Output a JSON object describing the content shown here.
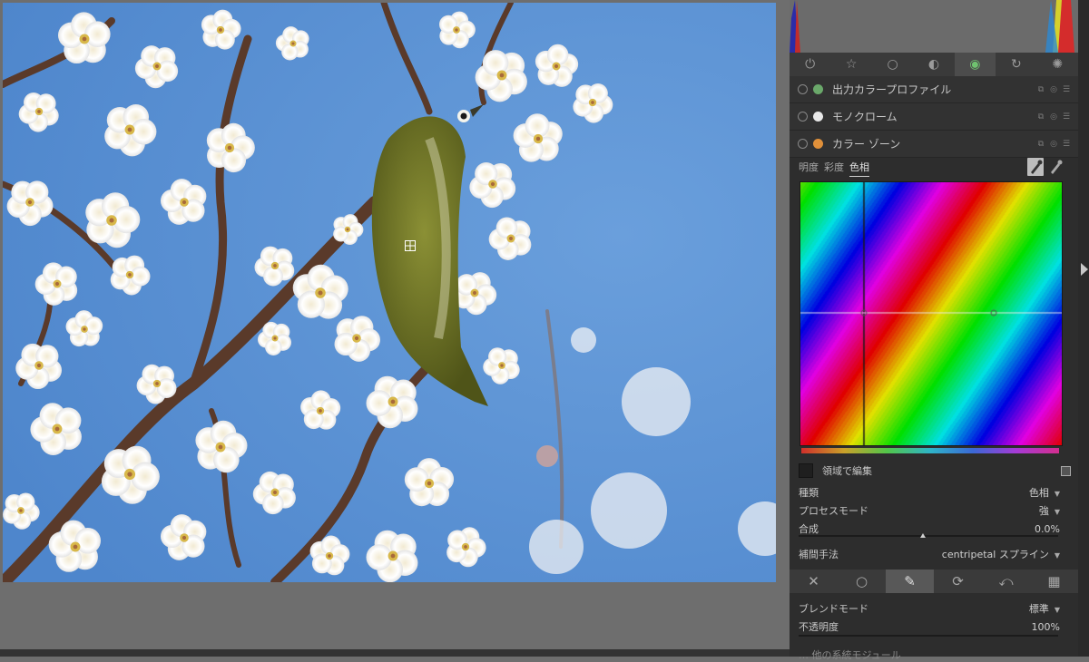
{
  "module_tabs": [
    {
      "icon": "power-icon",
      "glyph": "⏻"
    },
    {
      "icon": "star-icon",
      "glyph": "☆"
    },
    {
      "icon": "circle-icon",
      "glyph": "○"
    },
    {
      "icon": "half-circle-icon",
      "glyph": "◐"
    },
    {
      "icon": "color-wheel-icon",
      "glyph": "◉",
      "active": true
    },
    {
      "icon": "refresh-icon",
      "glyph": "↻"
    },
    {
      "icon": "aperture-icon",
      "glyph": "✺"
    }
  ],
  "modules": [
    {
      "name": "出力カラープロファイル",
      "icon": "output-color-profile-icon",
      "color": "#6aa86a"
    },
    {
      "name": "モノクローム",
      "icon": "monochrome-icon",
      "color": "#e8e8e8"
    },
    {
      "name": "カラー ゾーン",
      "icon": "color-zones-icon",
      "color": "#e0903a"
    }
  ],
  "module_buttons": [
    "⧉",
    "◎",
    "☰"
  ],
  "color_zones": {
    "tabs": [
      "明度",
      "彩度",
      "色相"
    ],
    "active_tab": "色相",
    "area_edit_label": "領域で編集",
    "params": [
      {
        "label": "種類",
        "value": "色相",
        "dropdown": true
      },
      {
        "label": "プロセスモード",
        "value": "強",
        "dropdown": true
      },
      {
        "label": "合成",
        "value": "0.0%",
        "dropdown": false
      },
      {
        "label": "補間手法",
        "value": "centripetal スプライン",
        "dropdown": true
      }
    ]
  },
  "blend_tabs": [
    {
      "icon": "off-icon",
      "glyph": "✕"
    },
    {
      "icon": "uniform-icon",
      "glyph": "○"
    },
    {
      "icon": "drawn-mask-icon",
      "glyph": "✎",
      "active": true
    },
    {
      "icon": "parametric-mask-icon",
      "glyph": "⟳"
    },
    {
      "icon": "drawn-parametric-icon",
      "glyph": "⤺"
    },
    {
      "icon": "raster-mask-icon",
      "glyph": "▦"
    }
  ],
  "blend": [
    {
      "label": "ブレンドモード",
      "value": "標準",
      "dropdown": true
    },
    {
      "label": "不透明度",
      "value": "100%",
      "dropdown": false
    }
  ],
  "partial_next_label": "… 他の系統モジュール"
}
